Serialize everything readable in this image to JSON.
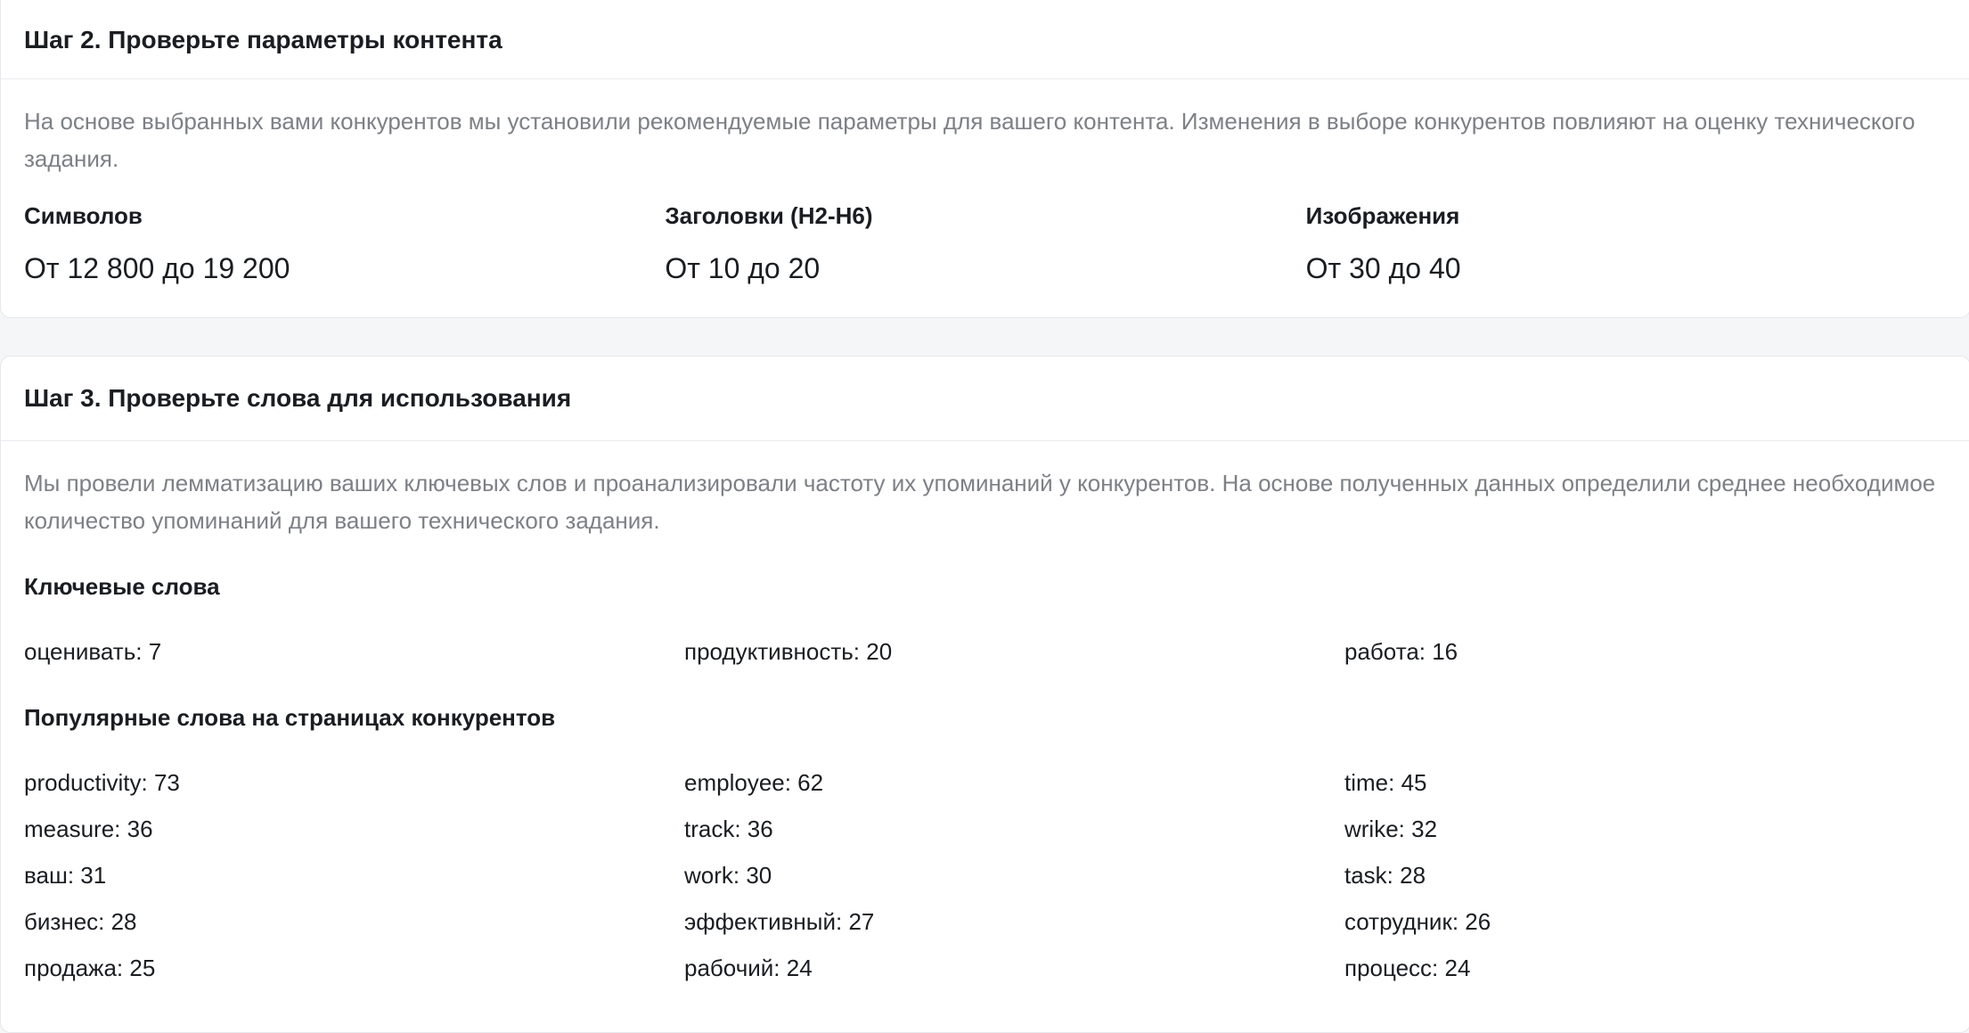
{
  "step2": {
    "title": "Шаг 2. Проверьте параметры контента",
    "description": "На основе выбранных вами конкурентов мы установили рекомендуемые параметры для вашего контента. Изменения в выборе конкурентов повлияют на оценку технического задания.",
    "params": [
      {
        "label": "Символов",
        "value": "От 12 800 до 19 200"
      },
      {
        "label": "Заголовки (H2-H6)",
        "value": "От 10 до 20"
      },
      {
        "label": "Изображения",
        "value": "От 30 до 40"
      }
    ]
  },
  "step3": {
    "title": "Шаг 3. Проверьте слова для использования",
    "description": "Мы провели лемматизацию ваших ключевых слов и проанализировали частоту их упоминаний у конкурентов. На основе полученных данных определили среднее необходимое количество упоминаний для вашего технического задания.",
    "keywords_title": "Ключевые слова",
    "keywords": [
      "оценивать: 7",
      "продуктивность: 20",
      "работа: 16"
    ],
    "popular_title": "Популярные слова на страницах конкурентов",
    "popular": [
      "productivity: 73",
      "employee: 62",
      "time: 45",
      "measure: 36",
      "track: 36",
      "wrike: 32",
      "ваш: 31",
      "work: 30",
      "task: 28",
      "бизнес: 28",
      "эффективный: 27",
      "сотрудник: 26",
      "продажа: 25",
      "рабочий: 24",
      "процесс: 24"
    ]
  }
}
